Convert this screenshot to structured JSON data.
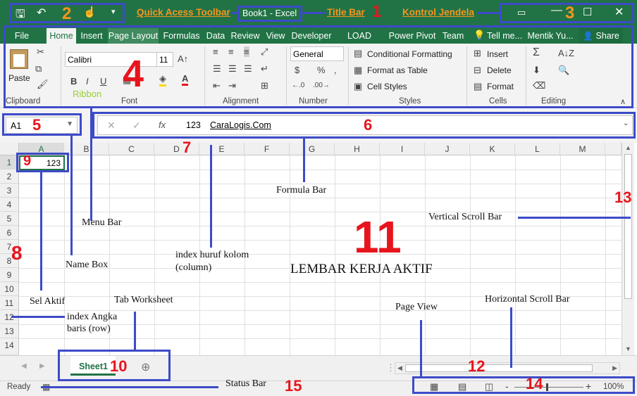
{
  "window": {
    "title": "Book1 - Excel",
    "tell_me": "Tell me...",
    "account": "Mentik Yu...",
    "share": "Share"
  },
  "tabs": [
    "File",
    "Home",
    "Insert",
    "Page Layout",
    "Formulas",
    "Data",
    "Review",
    "View",
    "Developer",
    "LOAD TEST",
    "Power Pivot",
    "Team"
  ],
  "ribbon": {
    "paste": "Paste",
    "font_name": "Calibri",
    "font_size": "11",
    "number_format": "General",
    "conditional_formatting": "Conditional Formatting",
    "format_as_table": "Format as Table",
    "cell_styles": "Cell Styles",
    "insert": "Insert",
    "delete": "Delete",
    "format": "Format",
    "groups": [
      "Clipboard",
      "Font",
      "Alignment",
      "Number",
      "Styles",
      "Cells",
      "Editing"
    ],
    "ribbon_annot": "Ribbon"
  },
  "formula_bar": {
    "name_box": "A1",
    "cancel": "✕",
    "enter": "✓",
    "fx": "fx",
    "value": "123",
    "watermark": "CaraLogis.Com"
  },
  "columns": [
    "A",
    "B",
    "C",
    "D",
    "E",
    "F",
    "G",
    "H",
    "I",
    "J",
    "K",
    "L",
    "M"
  ],
  "rows": [
    "1",
    "2",
    "3",
    "4",
    "5",
    "6",
    "7",
    "8",
    "9",
    "10",
    "11",
    "12",
    "13",
    "14"
  ],
  "cell_a1": "123",
  "sheet_tab": "Sheet1",
  "status": {
    "ready": "Ready",
    "zoom": "100%"
  },
  "annotations": {
    "n1": "1",
    "n2": "2",
    "n3": "3",
    "n4": "4",
    "n5": "5",
    "n6": "6",
    "n7": "7",
    "n8": "8",
    "n9": "9",
    "n10": "10",
    "n11": "11",
    "n12": "12",
    "n13": "13",
    "n14": "14",
    "n15": "15",
    "quick_access": "Quick Acess Toolbar",
    "title_bar": "Title Bar",
    "kontrol": "Kontrol Jendela",
    "formula_bar": "Formula Bar",
    "menu_bar": "Menu Bar",
    "name_box": "Name Box",
    "vertical_scroll": "Vertical Scroll Bar",
    "index_kolom": "index huruf kolom",
    "column": "(column)",
    "lembar": "LEMBAR KERJA AKTIF",
    "sel_aktif": "Sel Aktif",
    "tab_worksheet": "Tab Worksheet",
    "index_angka": "index Angka",
    "baris": "baris (row)",
    "page_view": "Page View",
    "horizontal_scroll": "Horizontal Scroll Bar",
    "status_bar": "Status Bar"
  },
  "colors": {
    "excel_green": "#217346",
    "annot_blue": "#3d4bc8",
    "annot_red": "#e8141d",
    "annot_orange": "#f7941d"
  }
}
